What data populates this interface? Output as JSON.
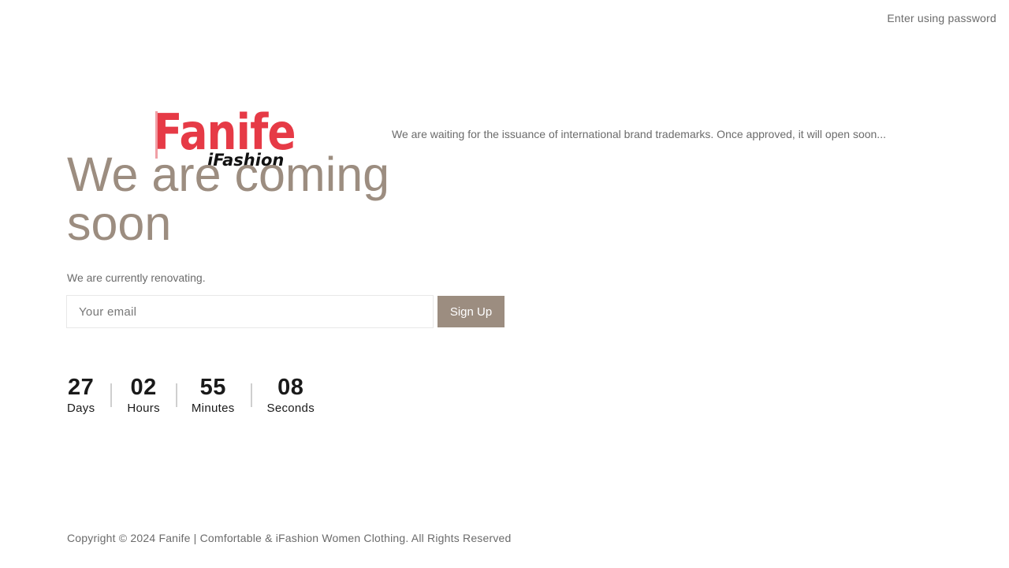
{
  "header": {
    "password_link": "Enter using password"
  },
  "brand": {
    "logo_main": "Fanife",
    "logo_sub": "iFashion",
    "tagline": "We are waiting for the issuance of international brand trademarks. Once approved, it will open soon...",
    "colors": {
      "logo_red": "#e63a46",
      "accent": "#9c8d80"
    }
  },
  "main": {
    "headline": "We are coming soon",
    "subtext": "We are currently renovating.",
    "email_placeholder": "Your email",
    "email_value": "",
    "signup_label": "Sign Up"
  },
  "countdown": {
    "days": {
      "value": "27",
      "label": "Days"
    },
    "hours": {
      "value": "02",
      "label": "Hours"
    },
    "minutes": {
      "value": "55",
      "label": "Minutes"
    },
    "seconds": {
      "value": "08",
      "label": "Seconds"
    }
  },
  "footer": {
    "copyright": "Copyright © 2024 Fanife | Comfortable & iFashion Women Clothing. All Rights Reserved"
  }
}
